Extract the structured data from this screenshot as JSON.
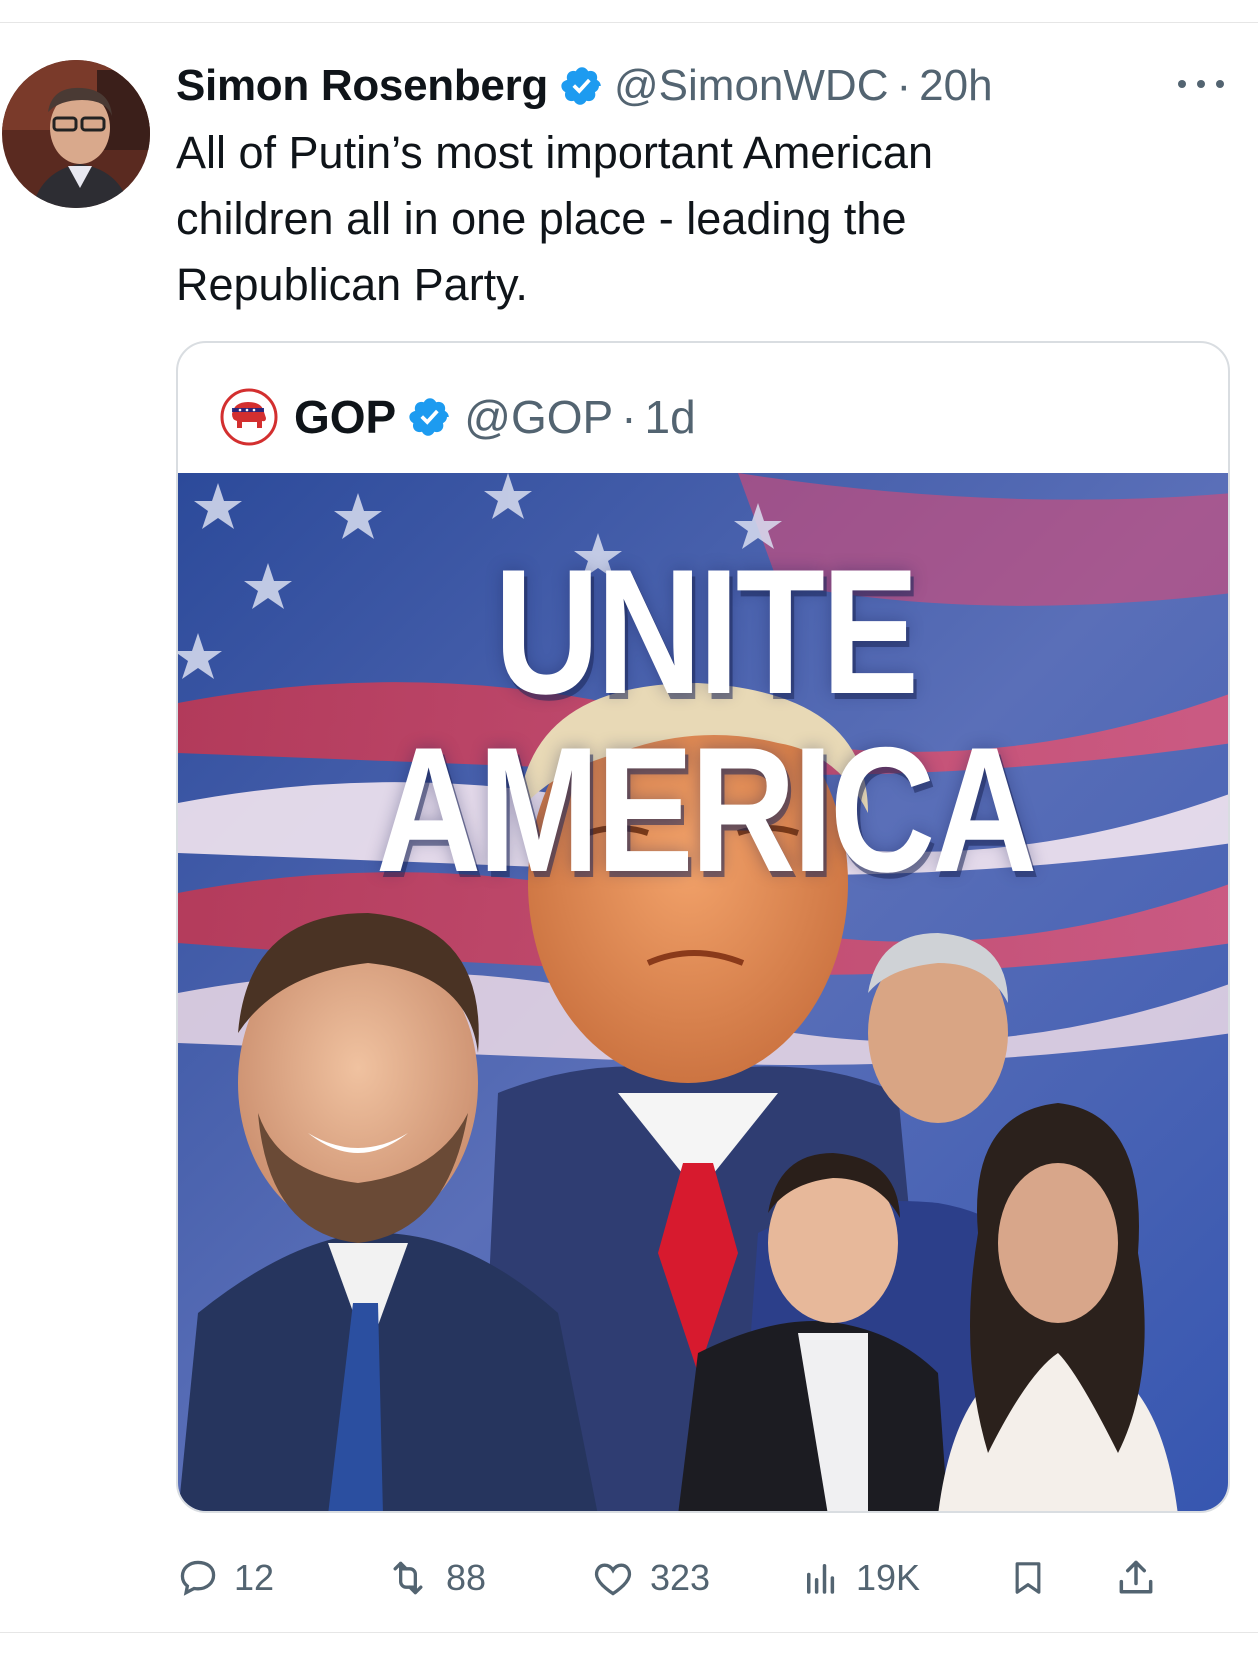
{
  "author": {
    "display_name": "Simon Rosenberg",
    "handle": "@SimonWDC",
    "separator": "·",
    "time": "20h",
    "verified_icon": "verified-badge-icon",
    "avatar_icon": "user-avatar"
  },
  "tweet": {
    "text": "All of Putin’s most important American\nchildren all in one place - leading the\nRepublican Party."
  },
  "quote": {
    "display_name": "GOP",
    "handle": "@GOP",
    "separator": "·",
    "time": "1d",
    "logo_icon": "gop-elephant-icon",
    "image_headline": "UNITE AMERICA"
  },
  "actions": {
    "reply_count": "12",
    "retweet_count": "88",
    "like_count": "323",
    "views_count": "19K"
  },
  "colors": {
    "accent": "#1d9bf0",
    "text": "#0f1419",
    "muted": "#536471",
    "gop_red": "#d32f2f"
  }
}
